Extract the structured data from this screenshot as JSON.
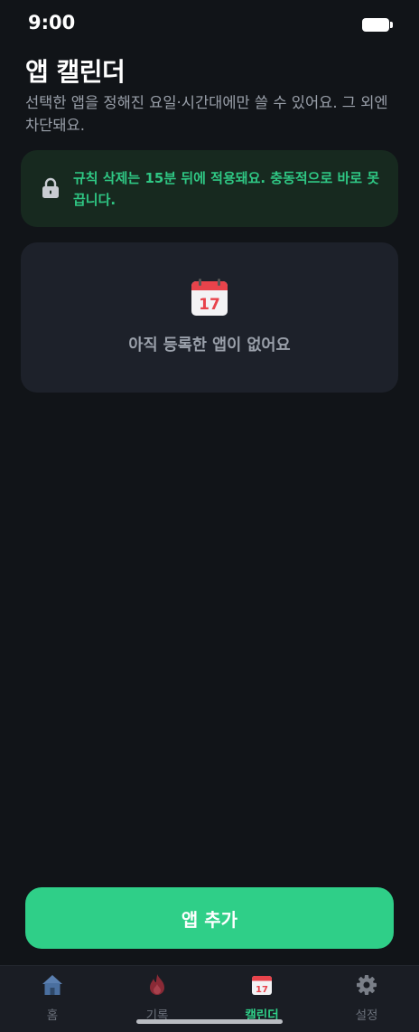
{
  "status": {
    "time": "9:00"
  },
  "header": {
    "title": "앱 캘린더",
    "subtitle": "선택한 앱을 정해진 요일·시간대에만 쓸 수 있어요. 그 외엔 차단돼요."
  },
  "notice": {
    "text": "규칙 삭제는 15분 뒤에 적용돼요. 충동적으로 바로 못 끕니다.",
    "icon": "lock-icon"
  },
  "empty_state": {
    "calendar_day": "17",
    "text": "아직 등록한 앱이 없어요",
    "icon": "calendar-icon"
  },
  "actions": {
    "add_label": "앱 추가"
  },
  "nav": {
    "items": [
      {
        "label": "홈",
        "icon": "home-icon",
        "active": false
      },
      {
        "label": "기록",
        "icon": "flame-icon",
        "active": false
      },
      {
        "label": "캘린더",
        "icon": "calendar-icon",
        "active": true,
        "calendar_day": "17"
      },
      {
        "label": "설정",
        "icon": "gear-icon",
        "active": false
      }
    ]
  },
  "colors": {
    "background": "#111418",
    "accent": "#2fcf88",
    "notice_bg": "#17291f",
    "card_bg": "#1d212a",
    "muted_text": "#9aa0aa"
  }
}
